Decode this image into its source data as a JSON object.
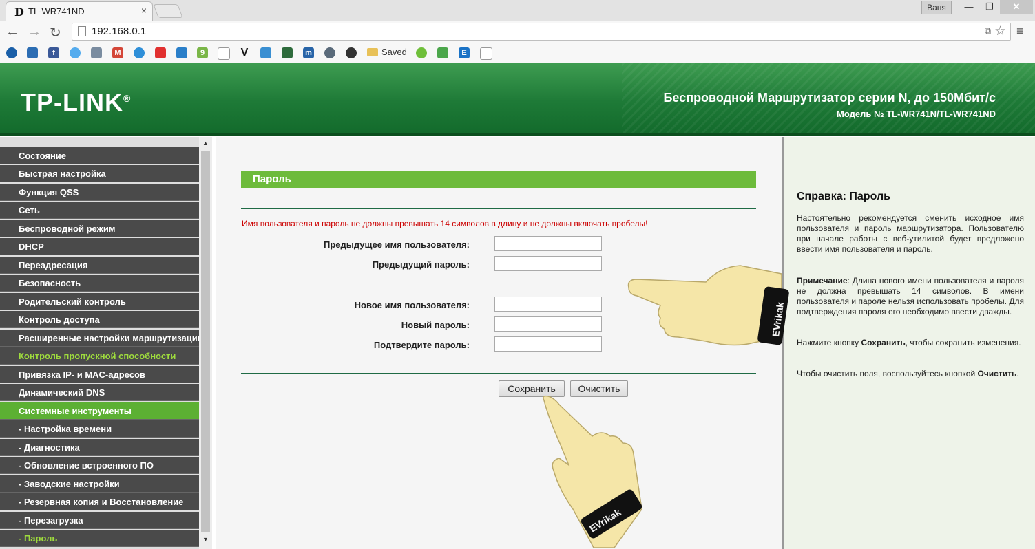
{
  "browser": {
    "tab_title": "TL-WR741ND",
    "tab_favicon": "D",
    "tab_close": "×",
    "user_badge": "Ваня",
    "url": "192.168.0.1",
    "bookmark_folder": "Saved"
  },
  "header": {
    "logo": "TP-LINK",
    "logo_mark": "®",
    "product_title": "Беспроводной Маршрутизатор серии N, до 150Мбит/с",
    "model": "Модель № TL-WR741N/TL-WR741ND"
  },
  "sidebar": {
    "items": [
      {
        "label": "Состояние"
      },
      {
        "label": "Быстрая настройка"
      },
      {
        "label": "Функция QSS"
      },
      {
        "label": "Сеть"
      },
      {
        "label": "Беспроводной режим"
      },
      {
        "label": "DHCP"
      },
      {
        "label": "Переадресация"
      },
      {
        "label": "Безопасность"
      },
      {
        "label": "Родительский контроль"
      },
      {
        "label": "Контроль доступа"
      },
      {
        "label": "Расширенные настройки маршрутизации"
      },
      {
        "label": "Контроль пропускной способности"
      },
      {
        "label": "Привязка IP- и MAC-адресов"
      },
      {
        "label": "Динамический DNS"
      },
      {
        "label": "Системные инструменты"
      },
      {
        "label": "- Настройка времени"
      },
      {
        "label": "- Диагностика"
      },
      {
        "label": "- Обновление встроенного ПО"
      },
      {
        "label": "- Заводские настройки"
      },
      {
        "label": "- Резервная копия и Восстановление"
      },
      {
        "label": "- Перезагрузка"
      },
      {
        "label": "- Пароль"
      }
    ]
  },
  "main": {
    "section_title": "Пароль",
    "warning": "Имя пользователя и пароль не должны превышать 14 символов в длину и не должны включать пробелы!",
    "fields": {
      "old_user": {
        "label": "Предыдущее имя пользователя:",
        "value": ""
      },
      "old_pass": {
        "label": "Предыдущий пароль:",
        "value": ""
      },
      "new_user": {
        "label": "Новое имя пользователя:",
        "value": ""
      },
      "new_pass": {
        "label": "Новый пароль:",
        "value": ""
      },
      "confirm_pass": {
        "label": "Подтвердите пароль:",
        "value": ""
      }
    },
    "save_label": "Сохранить",
    "clear_label": "Очистить"
  },
  "help": {
    "title": "Справка: Пароль",
    "p1": "Настоятельно рекомендуется сменить исходное имя пользователя и пароль маршрутизатора. Пользователю при начале работы с веб-утилитой будет предложено ввести имя пользователя и пароль.",
    "p2_bold": "Примечание",
    "p2": ": Длина нового имени пользователя и пароля не должна превышать 14 символов. В имени пользователя и пароле нельзя использовать пробелы. Для подтверждения пароля его необходимо ввести дважды.",
    "p3_pre": "Нажмите кнопку ",
    "p3_bold": "Сохранить",
    "p3_post": ", чтобы сохранить изменения.",
    "p4_pre": "Чтобы очистить поля, воспользуйтесь кнопкой ",
    "p4_bold": "Очистить",
    "p4_post": "."
  },
  "overlay": {
    "band_text": "EVrikak"
  },
  "colors": {
    "header_green": "#1e7a37",
    "accent_green": "#6dbb3b",
    "menu_dark": "#4a4a4a",
    "warning_red": "#cc0000",
    "help_bg": "#eef3e9"
  }
}
